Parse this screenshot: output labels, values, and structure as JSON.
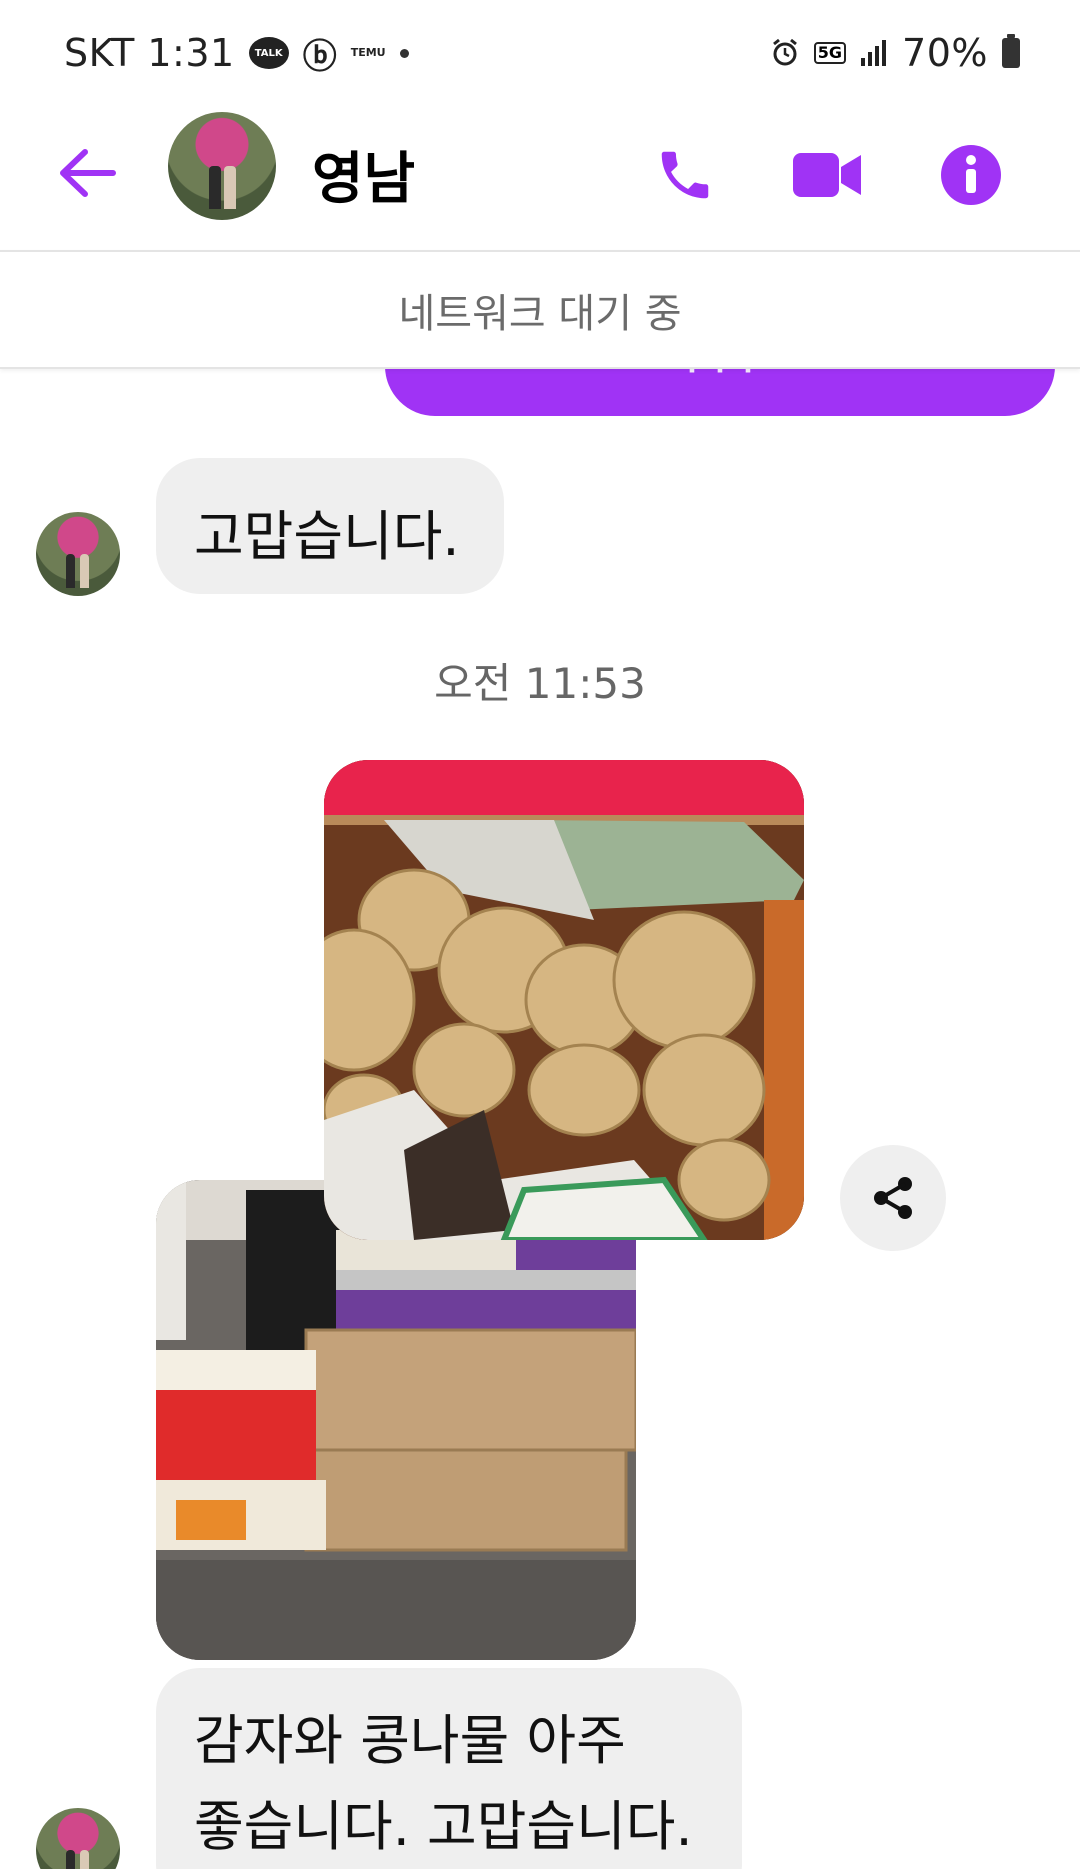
{
  "status_bar": {
    "carrier_time": "SKT 1:31",
    "talk_badge": "TALK",
    "temu_badge": "TEMU",
    "network": "5G",
    "battery": "70%"
  },
  "header": {
    "contact_name": "영남"
  },
  "banner": {
    "network_status": "네트워크 대기 중"
  },
  "messages": {
    "received_1": "고맙습니다.",
    "timestamp": "오전 11:53",
    "received_2_line1": "감자와 콩나물 아주",
    "received_2_line2": "좋습니다. 고맙습니다."
  },
  "colors": {
    "accent": "#a033f5",
    "received_bubble": "#efefef",
    "banner_text": "#6b6b6b"
  },
  "icons": {
    "back": "arrow-left-icon",
    "call": "phone-icon",
    "video": "video-camera-icon",
    "info": "info-icon",
    "share": "share-icon"
  }
}
